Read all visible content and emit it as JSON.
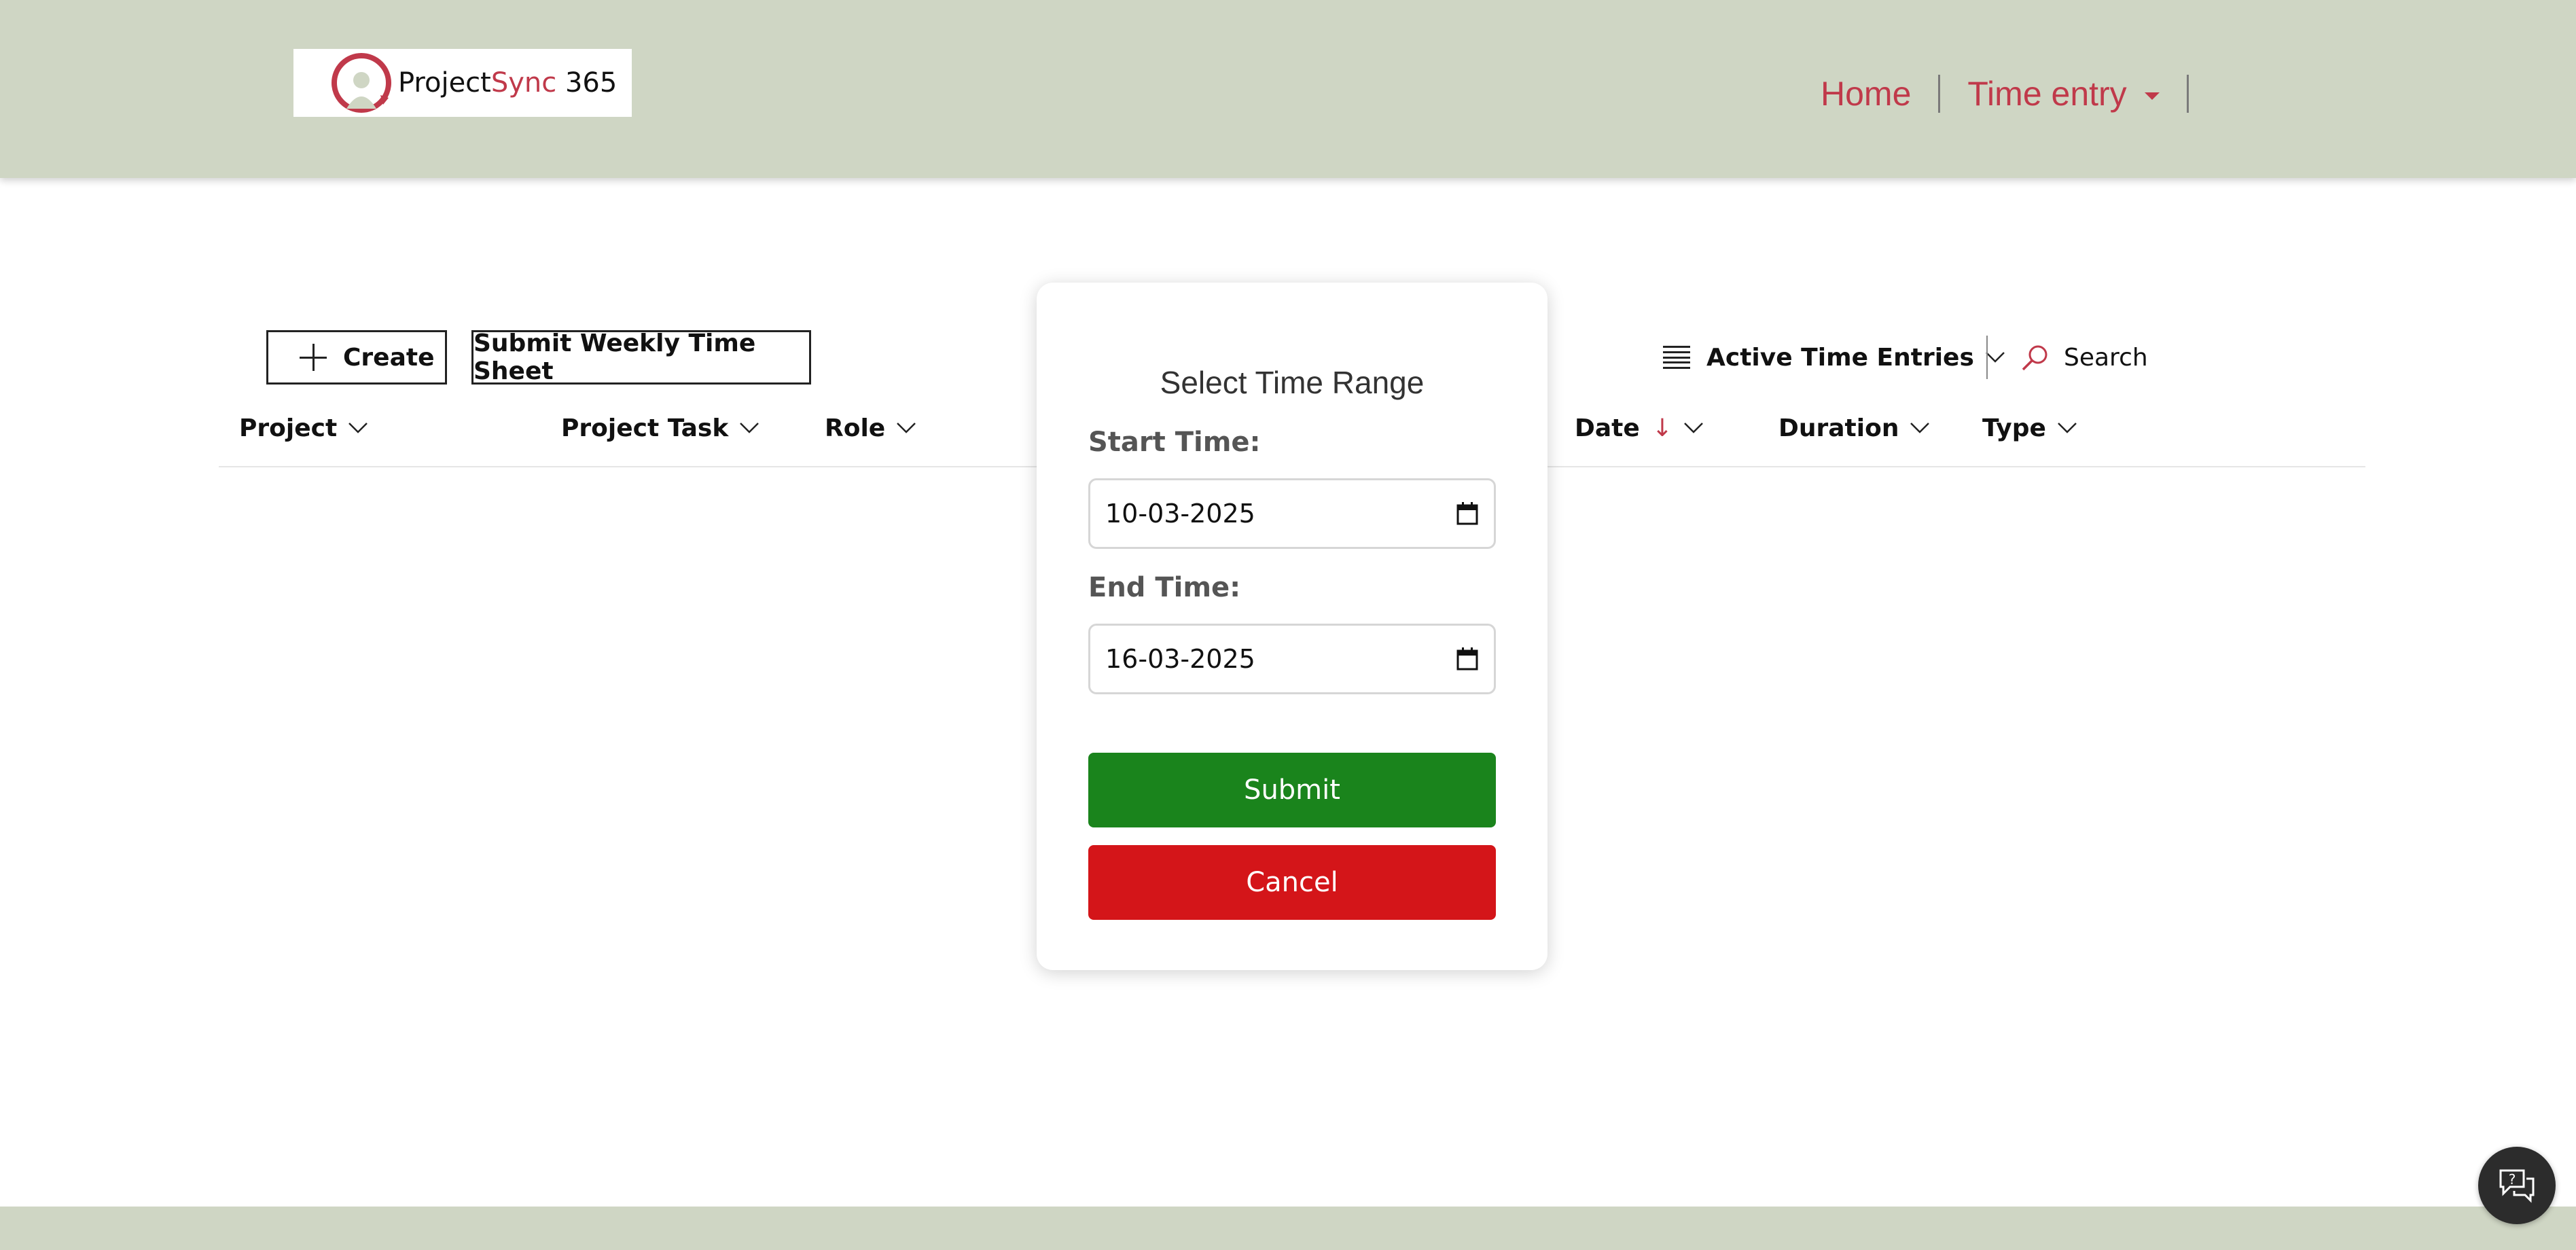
{
  "brand": {
    "name_part1": "Project",
    "name_part2": "Sync",
    "name_part3": " 365",
    "accent_color": "#c0394a",
    "header_color": "#cfd6c4"
  },
  "nav": {
    "home": "Home",
    "time_entry": "Time entry"
  },
  "toolbar": {
    "create_label": "Create",
    "submit_week_label": "Submit Weekly Time Sheet",
    "view_label": "Active Time Entries",
    "search_label": "Search"
  },
  "table": {
    "columns": [
      "Project",
      "Project Task",
      "Role",
      "Date",
      "Duration",
      "Type"
    ]
  },
  "modal": {
    "title": "Select Time Range",
    "start_label": "Start Time:",
    "start_value": "10-03-2025",
    "end_label": "End Time:",
    "end_value": "16-03-2025",
    "submit_label": "Submit",
    "cancel_label": "Cancel"
  },
  "icons": {
    "logo": "stopwatch-user-icon",
    "calendar": "calendar-icon",
    "search": "search-icon",
    "help": "help-chat-icon",
    "view": "list-lines-icon",
    "chevron": "chevron-down-icon"
  }
}
